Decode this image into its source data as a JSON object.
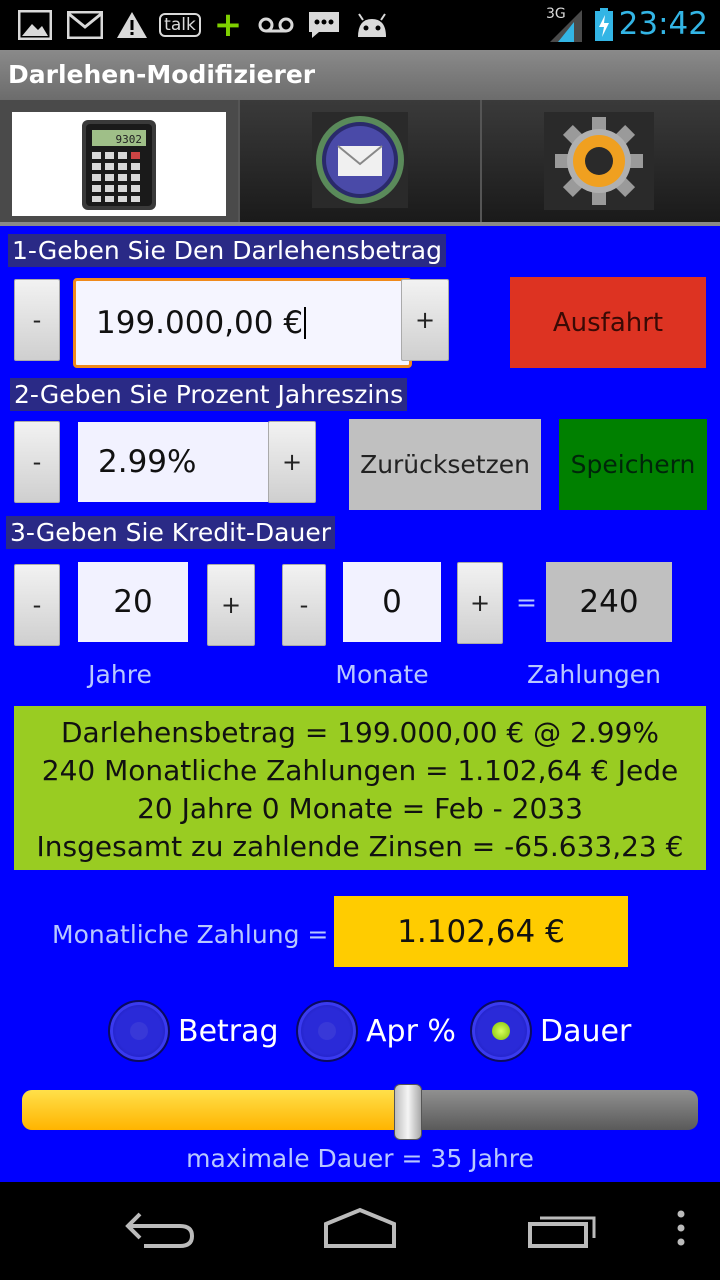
{
  "status_bar": {
    "time": "23:42",
    "network": "3G",
    "icons": [
      "gallery-icon",
      "gmail-icon",
      "warning-icon",
      "talk-icon",
      "plus-icon",
      "voicemail-icon",
      "sms-icon",
      "android-icon",
      "signal-icon",
      "battery-icon"
    ],
    "talk_text": "talk"
  },
  "app": {
    "title": "Darlehen-Modifizierer"
  },
  "tabs": [
    {
      "name": "calculator",
      "icon": "calculator-icon",
      "active": true
    },
    {
      "name": "mail",
      "icon": "mail-icon",
      "active": false
    },
    {
      "name": "settings",
      "icon": "gear-icon",
      "active": false
    }
  ],
  "calculator_display": "9302",
  "section1": {
    "header": "1-Geben Sie Den Darlehensbetrag",
    "minus": "-",
    "plus": "+",
    "amount_value": "199.000,00 €",
    "exit_label": "Ausfahrt"
  },
  "section2": {
    "header": "2-Geben Sie Prozent Jahreszins",
    "minus": "-",
    "plus": "+",
    "rate_value": "2.99%",
    "reset_label": "Zurücksetzen",
    "save_label": "Speichern"
  },
  "section3": {
    "header": "3-Geben Sie Kredit-Dauer",
    "years_minus": "-",
    "years_plus": "+",
    "years_value": "20",
    "months_minus": "-",
    "months_plus": "+",
    "months_value": "0",
    "equals": "=",
    "payments_value": "240",
    "years_label": "Jahre",
    "months_label": "Monate",
    "payments_label": "Zahlungen"
  },
  "summary": {
    "line1": "Darlehensbetrag = 199.000,00 € @ 2.99%",
    "line2": "240 Monatliche Zahlungen = 1.102,64 € Jede",
    "line3": "20 Jahre 0 Monate = Feb - 2033",
    "line4": "Insgesamt zu zahlende Zinsen = -65.633,23 €"
  },
  "monthly": {
    "label": "Monatliche Zahlung =",
    "value": "1.102,64 €"
  },
  "radios": [
    {
      "label": "Betrag",
      "selected": false
    },
    {
      "label": "Apr %",
      "selected": false
    },
    {
      "label": "Dauer",
      "selected": true
    }
  ],
  "slider": {
    "value_fraction": 0.57,
    "caption": "maximale Dauer = 35 Jahre"
  },
  "colors": {
    "background": "#0000ff",
    "exit_button": "#dd3322",
    "save_button": "#008000",
    "reset_button": "#c0c0c0",
    "summary_box": "#99cc22",
    "monthly_box": "#ffcc00",
    "focus_border": "#f08a1c",
    "clock": "#33b5e5"
  },
  "nav": [
    "back-icon",
    "home-icon",
    "recent-apps-icon",
    "menu-icon"
  ]
}
